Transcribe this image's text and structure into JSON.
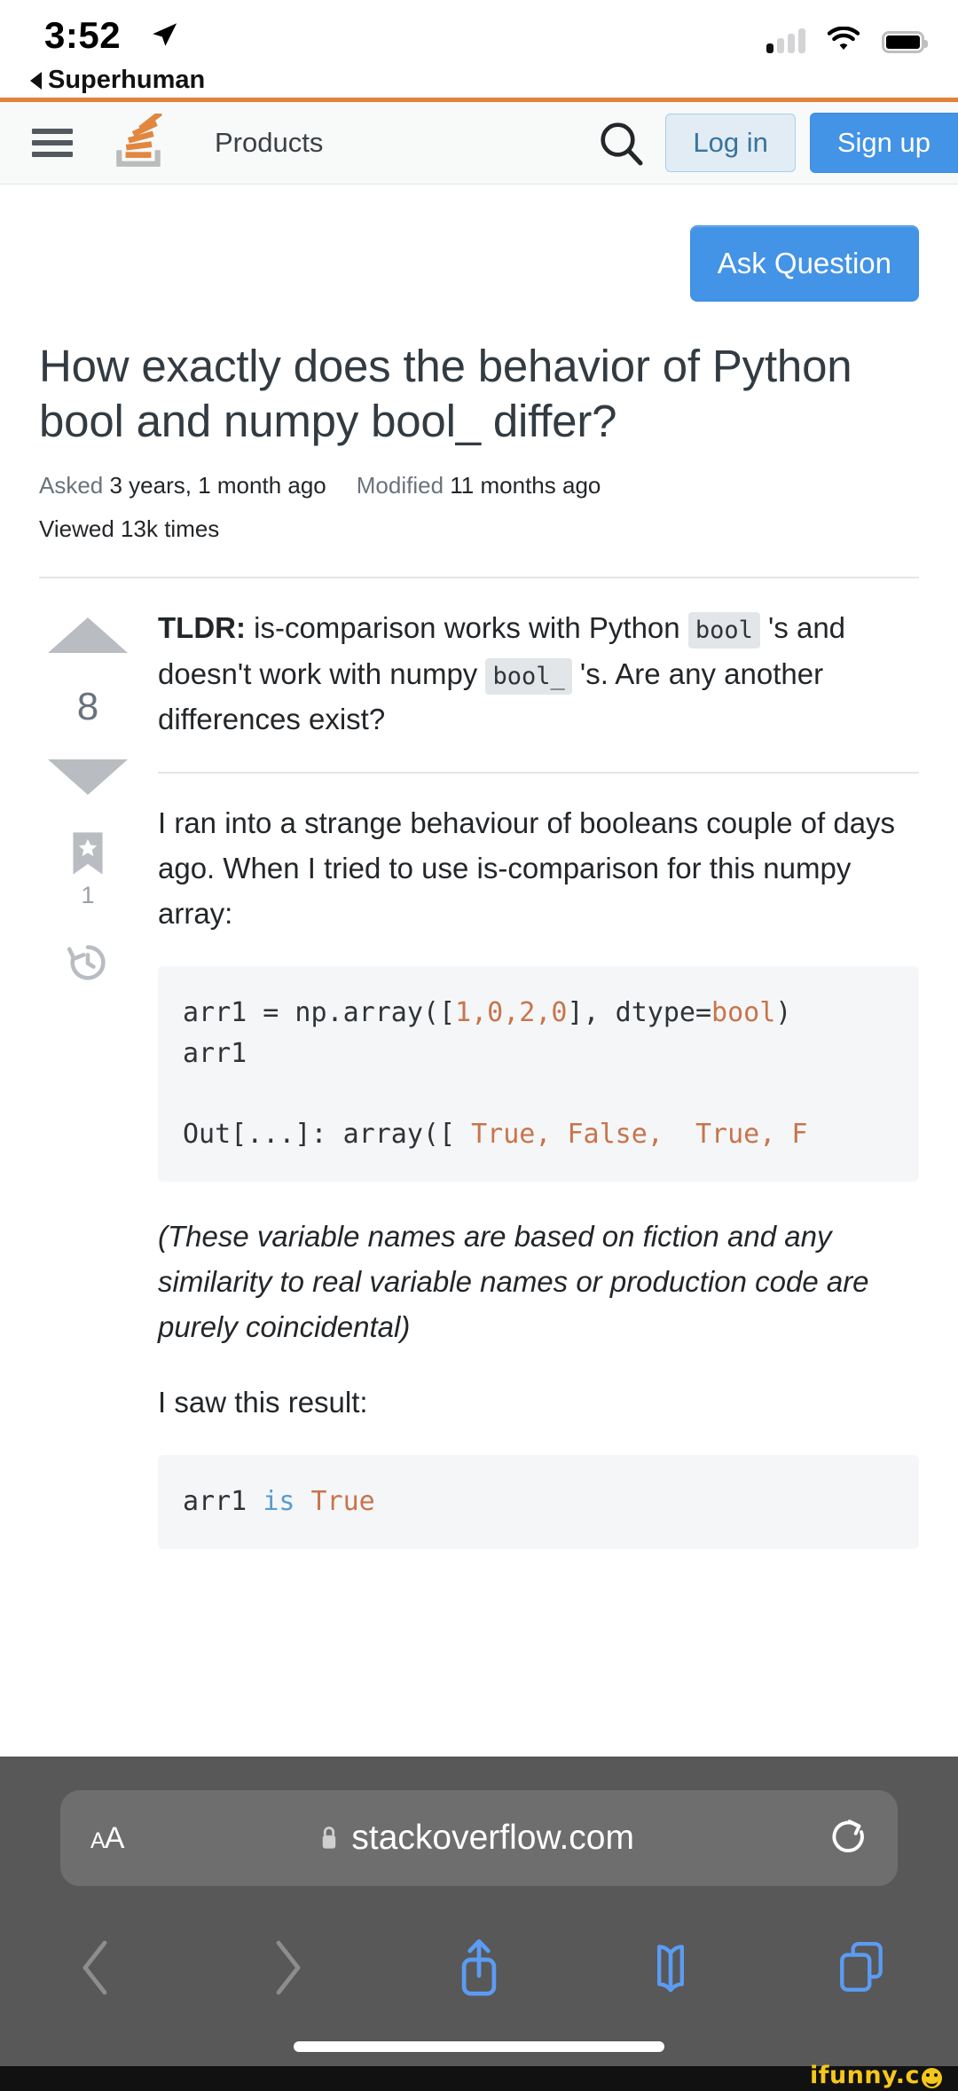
{
  "statusbar": {
    "time": "3:52",
    "back_app": "Superhuman",
    "location_icon": "location-arrow-icon",
    "signal_icon": "cellular-signal-icon",
    "wifi_icon": "wifi-icon",
    "battery_icon": "battery-full-icon"
  },
  "so_header": {
    "menu_icon": "hamburger-menu-icon",
    "logo_icon": "stackoverflow-logo-icon",
    "products_label": "Products",
    "search_icon": "search-icon",
    "login_label": "Log in",
    "signup_label": "Sign up",
    "accent_orange": "#e4813a",
    "accent_blue": "#4393e6"
  },
  "page": {
    "ask_button_label": "Ask Question",
    "title": "How exactly does the behavior of Python bool and numpy bool_ differ?",
    "meta": {
      "asked_label": "Asked",
      "asked_value": "3 years, 1 month ago",
      "modified_label": "Modified",
      "modified_value": "11 months ago",
      "viewed_label": "Viewed",
      "viewed_value": "13k times"
    }
  },
  "question": {
    "votes": {
      "upvote_icon": "upvote-arrow-icon",
      "score": "8",
      "downvote_icon": "downvote-arrow-icon",
      "bookmark_icon": "bookmark-star-icon",
      "bookmark_count": "1",
      "history_icon": "revision-history-icon"
    },
    "tldr": {
      "label": "TLDR:",
      "part1": " is-comparison works with Python ",
      "code1": "bool",
      "part2": " 's and doesn't work with numpy ",
      "code2": "bool_",
      "part3": " 's. Are any another differences exist?"
    },
    "paragraph1": "I ran into a strange behaviour of booleans couple of days ago. When I tried to use is-comparison for this numpy array:",
    "code_block1": {
      "line1_pre": "arr1 = np.array([",
      "line1_nums": "1,0,2,0",
      "line1_mid": "], dtype=",
      "line1_kw": "bool",
      "line1_post": ")",
      "line2": "arr1",
      "line3_pre": "Out[...]: array([ ",
      "line3_vals": "True, False,  True, F"
    },
    "paragraph2": "(These variable names are based on fiction and any similarity to real variable names or production code are purely coincidental)",
    "paragraph3": "I saw this result:",
    "code_block2": {
      "var": "arr1 ",
      "op": "is",
      "val": " True"
    }
  },
  "safari": {
    "text_size_label": "AA",
    "lock_icon": "lock-icon",
    "url": "stackoverflow.com",
    "reload_icon": "reload-icon",
    "back_icon": "back-chevron-icon",
    "forward_icon": "forward-chevron-icon",
    "share_icon": "share-icon",
    "bookmarks_icon": "bookmarks-book-icon",
    "tabs_icon": "tabs-icon",
    "home_indicator": "home-indicator"
  },
  "watermark": {
    "text": "ifunny.c",
    "color": "#f5c71a"
  }
}
